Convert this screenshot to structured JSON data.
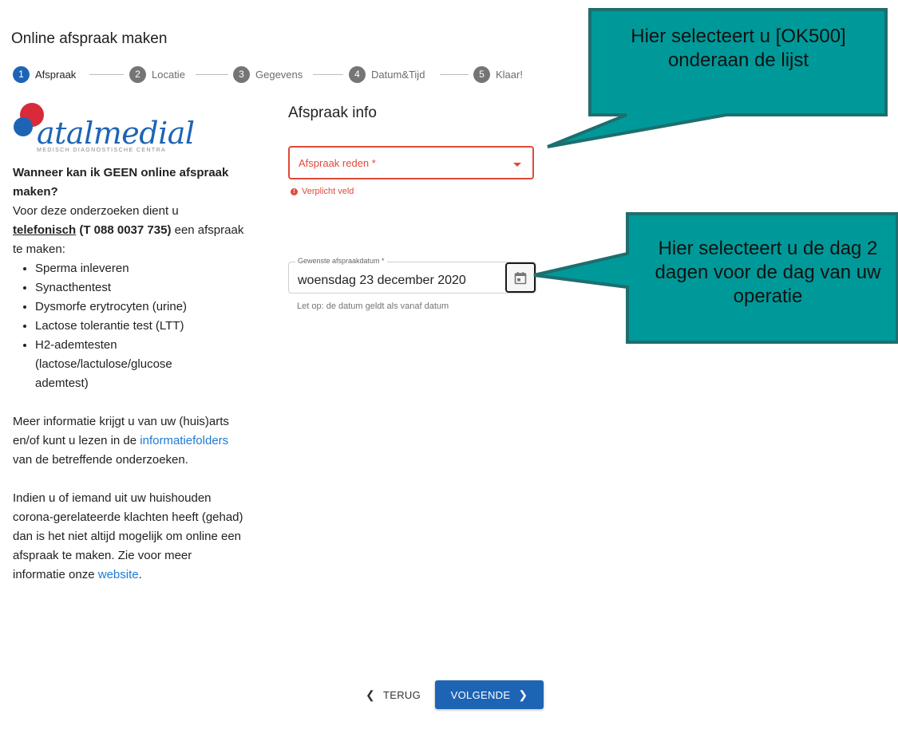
{
  "header": {
    "title": "Online afspraak maken"
  },
  "stepper": {
    "steps": [
      {
        "num": "1",
        "label": "Afspraak"
      },
      {
        "num": "2",
        "label": "Locatie"
      },
      {
        "num": "3",
        "label": "Gegevens"
      },
      {
        "num": "4",
        "label": "Datum&Tijd"
      },
      {
        "num": "5",
        "label": "Klaar!"
      }
    ],
    "active_step": 1
  },
  "logo": {
    "text": "atalmedial",
    "tagline": "MEDISCH DIAGNOSTISCHE CENTRA"
  },
  "sidebar": {
    "question": "Wanneer kan ik GEEN online afspraak maken?",
    "intro_before": "Voor deze onderzoeken dient u ",
    "intro_link": "telefonisch",
    "intro_phone": " (T 088 0037 735)",
    "intro_after": " een afspraak te maken:",
    "list": [
      "Sperma inleveren",
      "Synacthentest",
      "Dysmorfe erytrocyten (urine)",
      "Lactose tolerantie test (LTT)",
      "H2-ademtesten (lactose/lactulose/glucose ademtest)"
    ],
    "info_before": "Meer informatie krijgt u van uw (huis)arts en/of kunt u lezen in de ",
    "info_link": "informatiefolders",
    "info_after": " van de betreffende onderzoeken.",
    "corona_before": "Indien u of iemand uit uw huishouden corona-gerelateerde klachten heeft (gehad) dan is het niet altijd mogelijk om online een afspraak te maken. Zie voor meer informatie onze ",
    "corona_link": "website",
    "corona_after": "."
  },
  "form": {
    "title": "Afspraak info",
    "reason_label": "Afspraak reden *",
    "error_text": "Verplicht veld",
    "date_label": "Gewenste afspraakdatum *",
    "date_value": "woensdag 23 december 2020",
    "date_hint": "Let op: de datum geldt als vanaf datum"
  },
  "callouts": {
    "top": "Hier selecteert u [OK500] onderaan de lijst",
    "bottom": "Hier selecteert u de dag 2 dagen voor de dag van uw operatie"
  },
  "nav": {
    "back_label": "TERUG",
    "next_label": "VOLGENDE"
  },
  "colors": {
    "primary": "#1e64b4",
    "error": "#e04a3a",
    "link": "#1e7ad4",
    "callout_fill": "#009999",
    "callout_border": "#1e6e6e"
  },
  "icons": [
    "calendar-icon",
    "chevron-left-icon",
    "chevron-right-icon",
    "error-icon",
    "caret-down-icon"
  ]
}
